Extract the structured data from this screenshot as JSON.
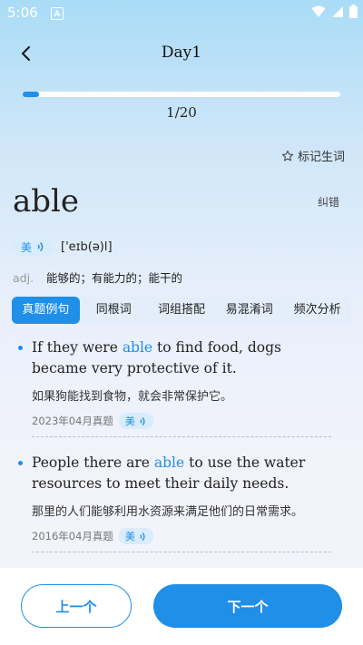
{
  "status": {
    "time": "5:06"
  },
  "header": {
    "title": "Day1"
  },
  "progress": {
    "label": "1/20",
    "fraction": 0.05
  },
  "actions": {
    "bookmark": "标记生词",
    "correct": "纠错"
  },
  "word": {
    "text": "able",
    "accent": "美",
    "phonetic": "['eɪb(ə)l]",
    "pos": "adj.",
    "meaning": "能够的；有能力的；能干的"
  },
  "tabs": [
    {
      "label": "真题例句",
      "active": true
    },
    {
      "label": "同根词",
      "active": false
    },
    {
      "label": "词组搭配",
      "active": false
    },
    {
      "label": "易混淆词",
      "active": false
    },
    {
      "label": "频次分析",
      "active": false
    }
  ],
  "examples": [
    {
      "before": "If they were ",
      "highlight": "able",
      "after": " to find food, dogs became very protective of it.",
      "translation": "如果狗能找到食物，就会非常保护它。",
      "source": "2023年04月真题",
      "accent": "美"
    },
    {
      "before": "People there are ",
      "highlight": "able",
      "after": " to use the water resources to meet their daily needs.",
      "translation": "那里的人们能够利用水资源来满足他们的日常需求。",
      "source": "2016年04月真题",
      "accent": "美"
    }
  ],
  "buttons": {
    "prev": "上一个",
    "next": "下一个"
  },
  "colors": {
    "accent": "#1f8fe7"
  },
  "icons": [
    "back-arrow-icon",
    "star-icon",
    "sound-icon",
    "wifi-icon",
    "cellular-icon",
    "battery-icon"
  ]
}
